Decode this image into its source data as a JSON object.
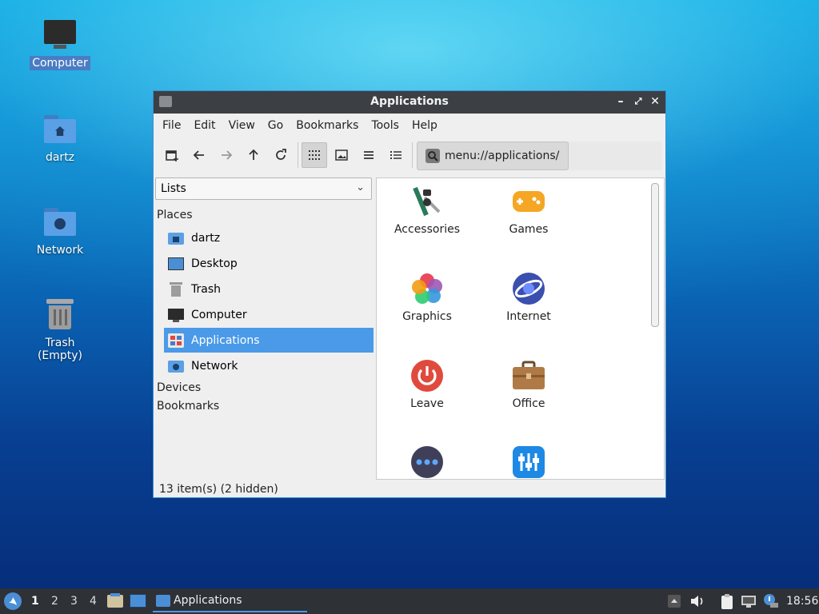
{
  "desktop": {
    "icons": [
      {
        "label": "Computer"
      },
      {
        "label": "dartz"
      },
      {
        "label": "Network"
      },
      {
        "label": "Trash (Empty)"
      }
    ]
  },
  "window": {
    "title": "Applications",
    "menu": [
      "File",
      "Edit",
      "View",
      "Go",
      "Bookmarks",
      "Tools",
      "Help"
    ],
    "location": "menu://applications/",
    "sidebar_mode": "Lists",
    "sections": {
      "places": "Places",
      "devices": "Devices",
      "bookmarks": "Bookmarks"
    },
    "places": [
      {
        "label": "dartz",
        "icon": "home-folder-icon"
      },
      {
        "label": "Desktop",
        "icon": "desktop-icon"
      },
      {
        "label": "Trash",
        "icon": "trash-icon"
      },
      {
        "label": "Computer",
        "icon": "computer-icon"
      },
      {
        "label": "Applications",
        "icon": "applications-icon",
        "active": true
      },
      {
        "label": "Network",
        "icon": "network-folder-icon"
      }
    ],
    "apps": [
      {
        "label": "Accessories",
        "icon": "accessories-icon"
      },
      {
        "label": "Games",
        "icon": "games-icon"
      },
      {
        "label": "Graphics",
        "icon": "graphics-icon"
      },
      {
        "label": "Internet",
        "icon": "internet-icon"
      },
      {
        "label": "Leave",
        "icon": "power-icon"
      },
      {
        "label": "Office",
        "icon": "briefcase-icon"
      },
      {
        "label": "",
        "icon": "other-icon"
      },
      {
        "label": "",
        "icon": "preferences-icon"
      }
    ],
    "status": "13 item(s) (2 hidden)"
  },
  "taskbar": {
    "workspaces": [
      "1",
      "2",
      "3",
      "4"
    ],
    "active_task": "Applications",
    "clock": "18:56"
  },
  "colors": {
    "accent": "#4a9ae8",
    "titlebar": "#3c3f44",
    "taskbar": "#2e3136"
  }
}
